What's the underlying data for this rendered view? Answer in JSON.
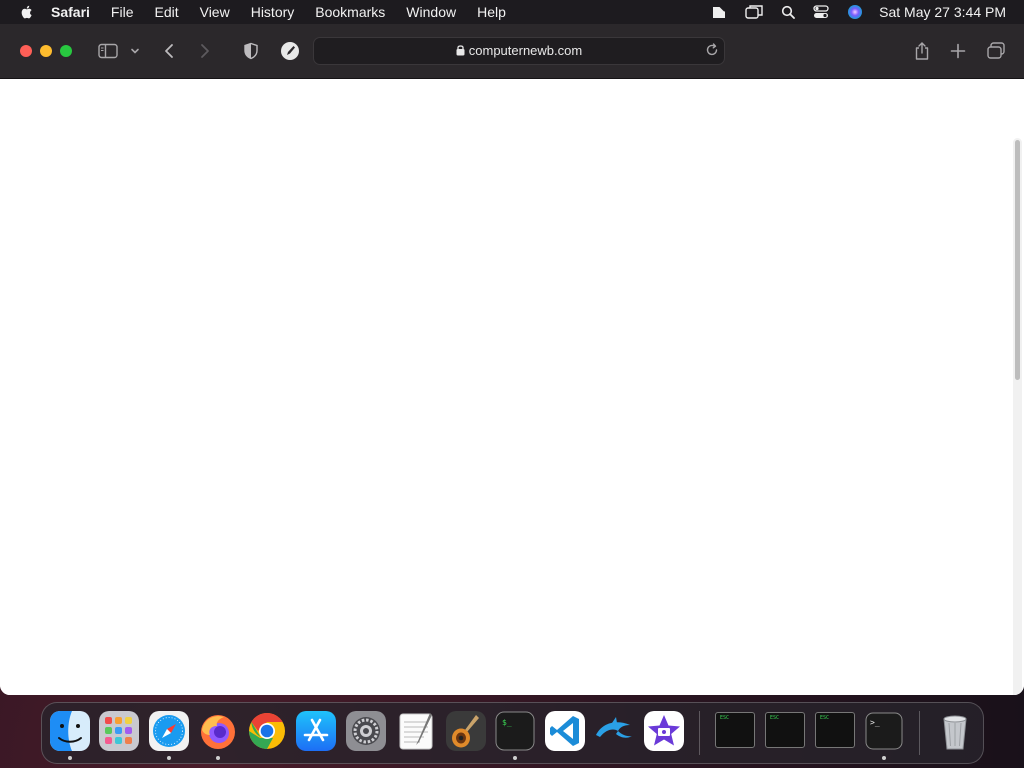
{
  "menubar": {
    "app_name": "Safari",
    "items": [
      "File",
      "Edit",
      "View",
      "History",
      "Bookmarks",
      "Window",
      "Help"
    ],
    "clock": "Sat May 27  3:44 PM",
    "status_icons": [
      "notes-icon",
      "screen-mirroring-icon",
      "spotlight-search-icon",
      "control-center-icon",
      "siri-icon"
    ]
  },
  "browser": {
    "url": "computernewb.com",
    "toolbar_icons": [
      "sidebar-icon",
      "chevron-down-icon",
      "back-arrow-icon",
      "forward-arrow-icon",
      "privacy-shield-icon",
      "extension-icon",
      "share-icon",
      "new-tab-plus-icon",
      "tab-overview-icon"
    ]
  },
  "dock": {
    "apps": [
      "Finder",
      "Launchpad",
      "Safari",
      "Firefox",
      "Google Chrome",
      "App Store",
      "System Preferences",
      "TextEdit",
      "GarageBand",
      "Terminal",
      "Visual Studio Code",
      "Dolphin",
      "iMovie"
    ],
    "minimized_windows": [
      "Terminal window 1",
      "Terminal window 2",
      "Terminal window 3",
      "Terminal"
    ],
    "trash": "Trash",
    "colors": {
      "finder": "#1e8df5",
      "safari": "#1a9bf0",
      "chrome_red": "#ea4335",
      "chrome_green": "#34a853",
      "chrome_yellow": "#fbbc05",
      "appstore": "#1d8cf8",
      "vscode": "#1b8cd8"
    }
  }
}
